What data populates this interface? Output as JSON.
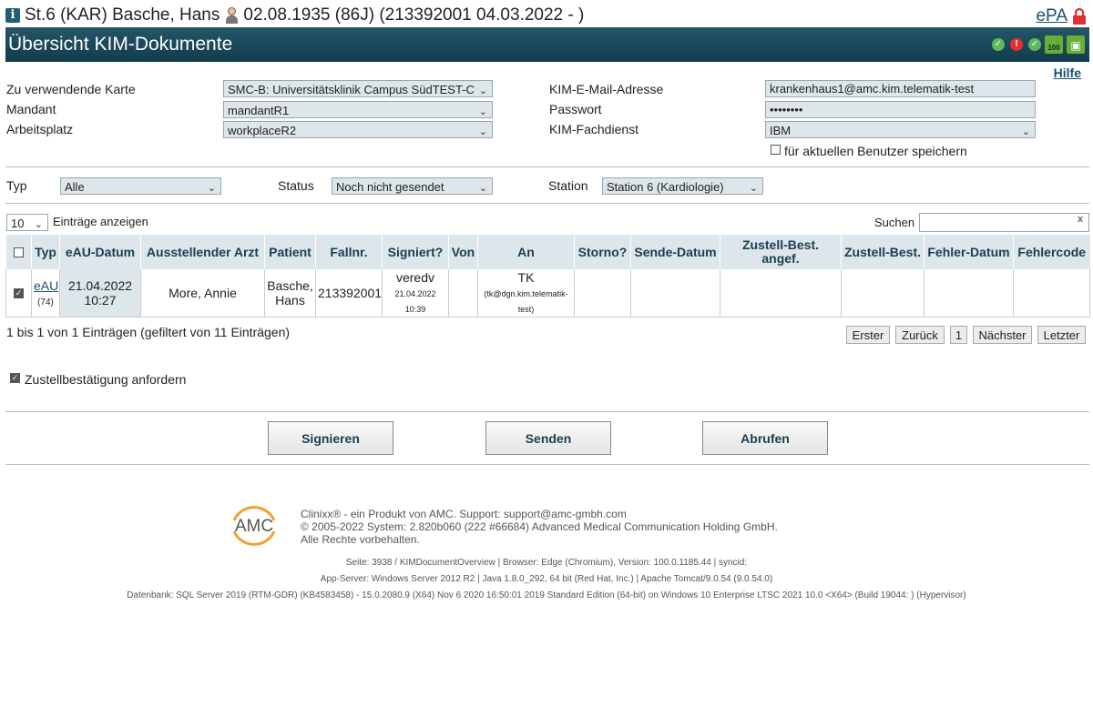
{
  "header": {
    "patient_prefix": "St.6 (KAR) Basche, Hans",
    "patient_suffix": "02.08.1935 (86J) (213392001 04.03.2022 - )",
    "epa_label": "ePA",
    "title": "Übersicht KIM-Dokumente",
    "battery_label": "100",
    "help_label": "Hilfe"
  },
  "form": {
    "card_label": "Zu verwendende Karte",
    "card_value": "SMC-B: Universitätsklinik Campus SüdTEST-C",
    "mandant_label": "Mandant",
    "mandant_value": "mandantR1",
    "workplace_label": "Arbeitsplatz",
    "workplace_value": "workplaceR2",
    "email_label": "KIM-E-Mail-Adresse",
    "email_value": "krankenhaus1@amc.kim.telematik-test",
    "password_label": "Passwort",
    "password_value": "••••••••",
    "service_label": "KIM-Fachdienst",
    "service_value": "IBM",
    "save_user_label": "für aktuellen Benutzer speichern"
  },
  "filters": {
    "type_label": "Typ",
    "type_value": "Alle",
    "status_label": "Status",
    "status_value": "Noch nicht gesendet",
    "station_label": "Station",
    "station_value": "Station 6 (Kardiologie)"
  },
  "table_controls": {
    "page_size": "10",
    "entries_label": "Einträge anzeigen",
    "search_label": "Suchen",
    "search_value": "",
    "clear_glyph": "x"
  },
  "table": {
    "headers": [
      "Typ",
      "eAU-Datum",
      "Ausstellender Arzt",
      "Patient",
      "Fallnr.",
      "Signiert?",
      "Von",
      "An",
      "Storno?",
      "Sende-Datum",
      "Zustell-Best. angef.",
      "Zustell-Best.",
      "Fehler-Datum",
      "Fehlercode"
    ],
    "rows": [
      {
        "type": "eAU",
        "type_count": "(74)",
        "date": "21.04.2022",
        "time": "10:27",
        "doctor": "More, Annie",
        "patient": "Basche, Hans",
        "case_no": "213392001",
        "signed_by": "veredv",
        "signed_date": "21.04.2022",
        "signed_time": "10:39",
        "from": "",
        "to": "TK",
        "to_email": "(tk@dgn.kim.telematik-test)",
        "storno": "",
        "send_date": "",
        "delivery_requested": "",
        "delivery": "",
        "error_date": "",
        "error_code": ""
      }
    ]
  },
  "pagination": {
    "info": "1 bis 1 von 1 Einträgen (gefiltert von 11 Einträgen)",
    "first": "Erster",
    "back": "Zurück",
    "current": "1",
    "next": "Nächster",
    "last": "Letzter"
  },
  "delivery_confirmation_label": "Zustellbestätigung anfordern",
  "actions": {
    "sign": "Signieren",
    "send": "Senden",
    "fetch": "Abrufen"
  },
  "footer": {
    "logo_text": "AMC",
    "line1": "Clinixx® - ein Produkt von AMC. Support: support@amc-gmbh.com",
    "line2": "© 2005-2022 System: 2.820b060 (222 #66684) Advanced Medical Communication Holding GmbH.",
    "line3": "Alle Rechte vorbehalten.",
    "info1": "Seite: 3938 / KIMDocumentOverview | Browser: Edge (Chromium), Version: 100.0.1185.44 | syncid:",
    "info2": "App-Server: Windows Server 2012 R2 | Java 1.8.0_292, 64 bit (Red Hat, Inc.) | Apache Tomcat/9.0.54 (9.0.54.0)",
    "info3": "Datenbank: SQL Server 2019 (RTM-GDR) (KB4583458) - 15.0.2080.9 (X64) Nov 6 2020 16:50:01 2019 Standard Edition (64-bit) on Windows 10 Enterprise LTSC 2021 10.0 <X64> (Build 19044: ) (Hypervisor)"
  },
  "colors": {
    "title_bar": "#1b4a5d",
    "accent": "#1a4f6e",
    "ok": "#5cb85c",
    "alert": "#e03030",
    "header_cell": "#dde6ea"
  }
}
